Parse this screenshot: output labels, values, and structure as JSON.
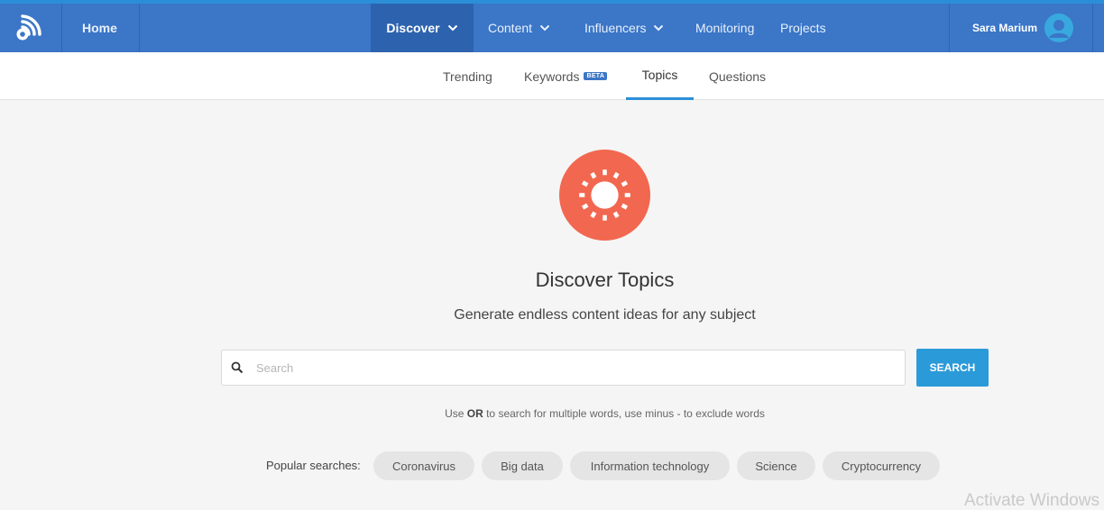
{
  "header": {
    "nav": [
      {
        "label": "Home"
      },
      {
        "label": "Discover"
      },
      {
        "label": "Content"
      },
      {
        "label": "Influencers"
      },
      {
        "label": "Monitoring"
      },
      {
        "label": "Projects"
      }
    ],
    "user_name": "Sara Marium"
  },
  "subnav": {
    "tabs": [
      {
        "label": "Trending"
      },
      {
        "label": "Keywords",
        "badge": "BETA"
      },
      {
        "label": "Topics"
      },
      {
        "label": "Questions"
      }
    ],
    "active_tab": "Topics"
  },
  "main": {
    "title": "Discover Topics",
    "subtitle": "Generate endless content ideas for any subject",
    "search": {
      "placeholder": "Search",
      "value": "",
      "button_label": "SEARCH"
    },
    "hint": {
      "prefix": "Use ",
      "bold": "OR",
      "suffix": " to search for multiple words, use minus - to exclude words"
    },
    "popular_label": "Popular searches:",
    "popular": [
      "Coronavirus",
      "Big data",
      "Information technology",
      "Science",
      "Cryptocurrency"
    ]
  },
  "watermark": "Activate Windows",
  "colors": {
    "header_bg": "#3b76c7",
    "active_nav_bg": "#2d63ae",
    "accent": "#2b9ad8",
    "hero_icon": "#f2674f"
  }
}
